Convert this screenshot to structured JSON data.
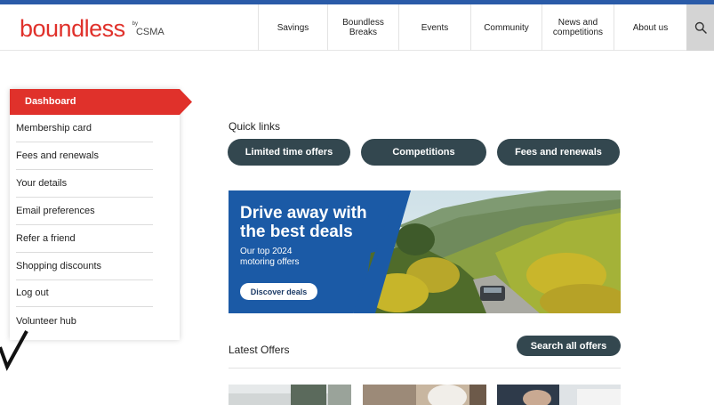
{
  "colors": {
    "brand_red": "#e0312b",
    "top_bar_blue": "#2a5ba8",
    "pill_dark": "#33474f",
    "banner_blue": "#1b5aa6"
  },
  "header": {
    "logo": {
      "word": "boundless",
      "by": "by",
      "org": "CSMA"
    },
    "nav": [
      {
        "label": "Savings"
      },
      {
        "label": "Boundless\nBreaks"
      },
      {
        "label": "Events"
      },
      {
        "label": "Community"
      },
      {
        "label": "News and\ncompetitions"
      },
      {
        "label": "About us"
      }
    ],
    "search_icon": "search-icon"
  },
  "sidebar": {
    "active": "Dashboard",
    "items": [
      "Membership card",
      "Fees and renewals",
      "Your details",
      "Email preferences",
      "Refer a friend",
      "Shopping discounts",
      "Log out",
      "Volunteer hub"
    ]
  },
  "quick_links": {
    "title": "Quick links",
    "items": [
      "Limited time offers",
      "Competitions",
      "Fees and renewals"
    ]
  },
  "banner": {
    "headline_1": "Drive away with",
    "headline_2": "the best deals",
    "sub_1": "Our top 2024",
    "sub_2": "motoring offers",
    "button": "Discover deals"
  },
  "latest": {
    "title": "Latest Offers",
    "search_button": "Search all offers"
  }
}
